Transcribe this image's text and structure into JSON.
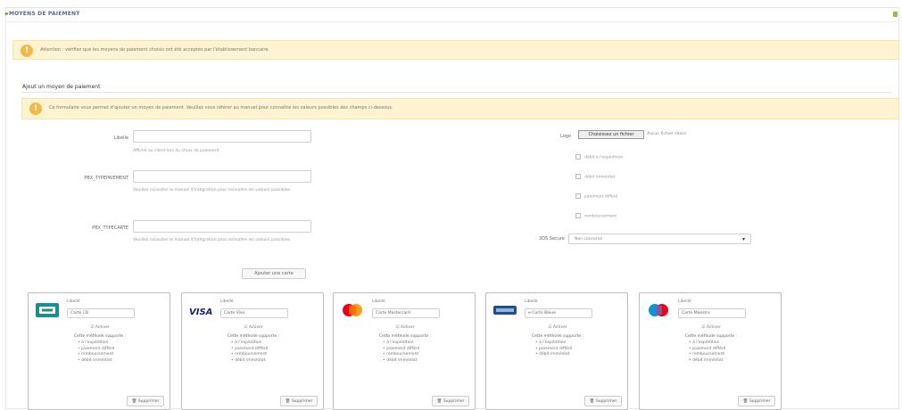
{
  "header": {
    "title": "MOYENS DE PAIEMENT"
  },
  "alert_top": {
    "text": "Attention : vérifiez que les moyens de paiement choisis ont été acceptés par l'établissement bancaire."
  },
  "section": {
    "title": "Ajout un moyen de paiement"
  },
  "alert_form": {
    "text": "Ce formulaire vous permet d'ajouter un moyen de paiement. Veuillez vous référer au manuel pour connaître les valeurs possibles des champs ci-dessous."
  },
  "form": {
    "libelle_label": "Libellé",
    "libelle_help": "Affiché au client lors du choix de paiement",
    "type_paiement_label": "PBX_TYPEPAIEMENT",
    "type_paiement_help": "Veuillez consulter le manuel d'intégration pour connaître les valeurs possibles.",
    "type_carte_label": "PBX_TYPECARTE",
    "type_carte_help": "Veuillez consulter le manuel d'intégration pour connaître les valeurs possibles.",
    "add_button": "Ajouter une carte",
    "logo_label": "Logo",
    "file_button": "Choisissez un fichier",
    "file_status": "Aucun fichier choisi",
    "checkboxes": [
      "débit à l'expédition",
      "débit immédiat",
      "paiement différé",
      "remboursement"
    ],
    "select_label": "3DS Secure",
    "select_value": "Non concerné"
  },
  "cards": [
    {
      "name": "CB",
      "libelle_label": "Libellé",
      "libelle_value": "Carte CB",
      "active": "Activer",
      "methods_title": "Cette méthode supporte :",
      "methods": [
        "à l'expédition",
        "paiement différé",
        "remboursement",
        "débit immédiat"
      ],
      "delete": "Supprimer"
    },
    {
      "name": "Visa",
      "libelle_label": "Libellé",
      "libelle_value": "Carte Visa",
      "active": "Activer",
      "methods_title": "Cette méthode supporte :",
      "methods": [
        "à l'expédition",
        "paiement différé",
        "remboursement",
        "débit immédiat"
      ],
      "delete": "Supprimer"
    },
    {
      "name": "Mastercard",
      "libelle_label": "Libellé",
      "libelle_value": "Carte Mastercard",
      "active": "Activer",
      "methods_title": "Cette méthode supporte :",
      "methods": [
        "à l'expédition",
        "paiement différé",
        "remboursement",
        "débit immédiat"
      ],
      "delete": "Supprimer"
    },
    {
      "name": "E-Carte Bleue",
      "libelle_label": "Libellé",
      "libelle_value": "e-Carte Bleue",
      "active": "Activer",
      "methods_title": "Cette méthode supporte :",
      "methods": [
        "à l'expédition",
        "paiement différé",
        "débit immédiat"
      ],
      "delete": "Supprimer"
    },
    {
      "name": "Maestro",
      "libelle_label": "Libellé",
      "libelle_value": "Carte Maestro",
      "active": "Activer",
      "methods_title": "Cette méthode supporte :",
      "methods": [
        "à l'expédition",
        "paiement différé",
        "remboursement",
        "débit immédiat"
      ],
      "delete": "Supprimer"
    }
  ],
  "colors": {
    "alert_bg": "#fff3d1",
    "alert_icon": "#f1b94a",
    "header_text": "#5a6a8a"
  }
}
